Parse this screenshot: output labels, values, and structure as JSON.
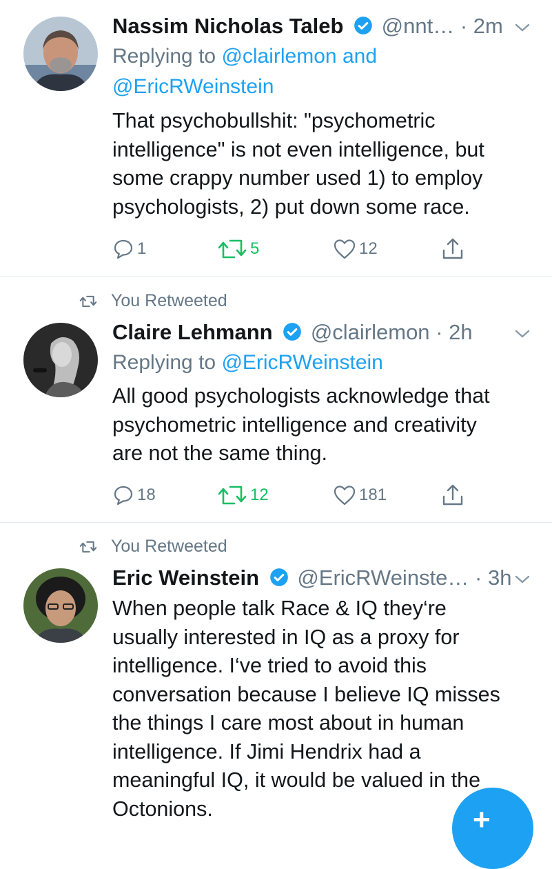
{
  "tweets": [
    {
      "name": "Nassim Nicholas Taleb",
      "handle": "@nnt…",
      "time": "· 2m",
      "replying_prefix": "Replying to ",
      "replying_to_1": "@clairlemon",
      "replying_and": " and",
      "replying_to_2": "@EricRWeinstein",
      "text_lines": [
        "That psychobullshit: \"psychometric",
        "intelligence\" is not even intelligence, but",
        "some crappy number used 1) to employ",
        "psychologists, 2) put down some race."
      ],
      "replies": "1",
      "retweets": "5",
      "likes": "12"
    },
    {
      "retweeted_label": "You Retweeted",
      "name": "Claire Lehmann",
      "handle": "@clairlemon",
      "time": "· 2h",
      "replying_prefix": "Replying to ",
      "replying_to_1": "@EricRWeinstein",
      "text_lines": [
        "All good psychologists acknowledge that",
        "psychometric intelligence and creativity",
        "are not the same thing."
      ],
      "replies": "18",
      "retweets": "12",
      "likes": "181"
    },
    {
      "retweeted_label": "You Retweeted",
      "name": "Eric Weinstein",
      "handle": "@EricRWeinste…",
      "time": "· 3h",
      "text_lines": [
        "When people talk Race & IQ they‘re",
        "usually interested in IQ as a proxy for",
        "intelligence. I‘ve tried to avoid this",
        "conversation because I believe IQ misses",
        "the things I care most about in human",
        "intelligence. If Jimi Hendrix had a",
        "meaningful IQ, it would be valued in the",
        "Octonions."
      ]
    }
  ],
  "fab_symbol": "+",
  "icons": {
    "verified": "verified-badge-icon",
    "chevron": "chevron-down-icon",
    "reply": "reply-icon",
    "retweet": "retweet-icon",
    "like": "heart-icon",
    "share": "share-icon",
    "compose": "compose-tweet-icon"
  },
  "colors": {
    "link": "#1da1f2",
    "secondary_text": "#657786",
    "retweet_green": "#17bf63",
    "separator": "#e1e8ed"
  }
}
